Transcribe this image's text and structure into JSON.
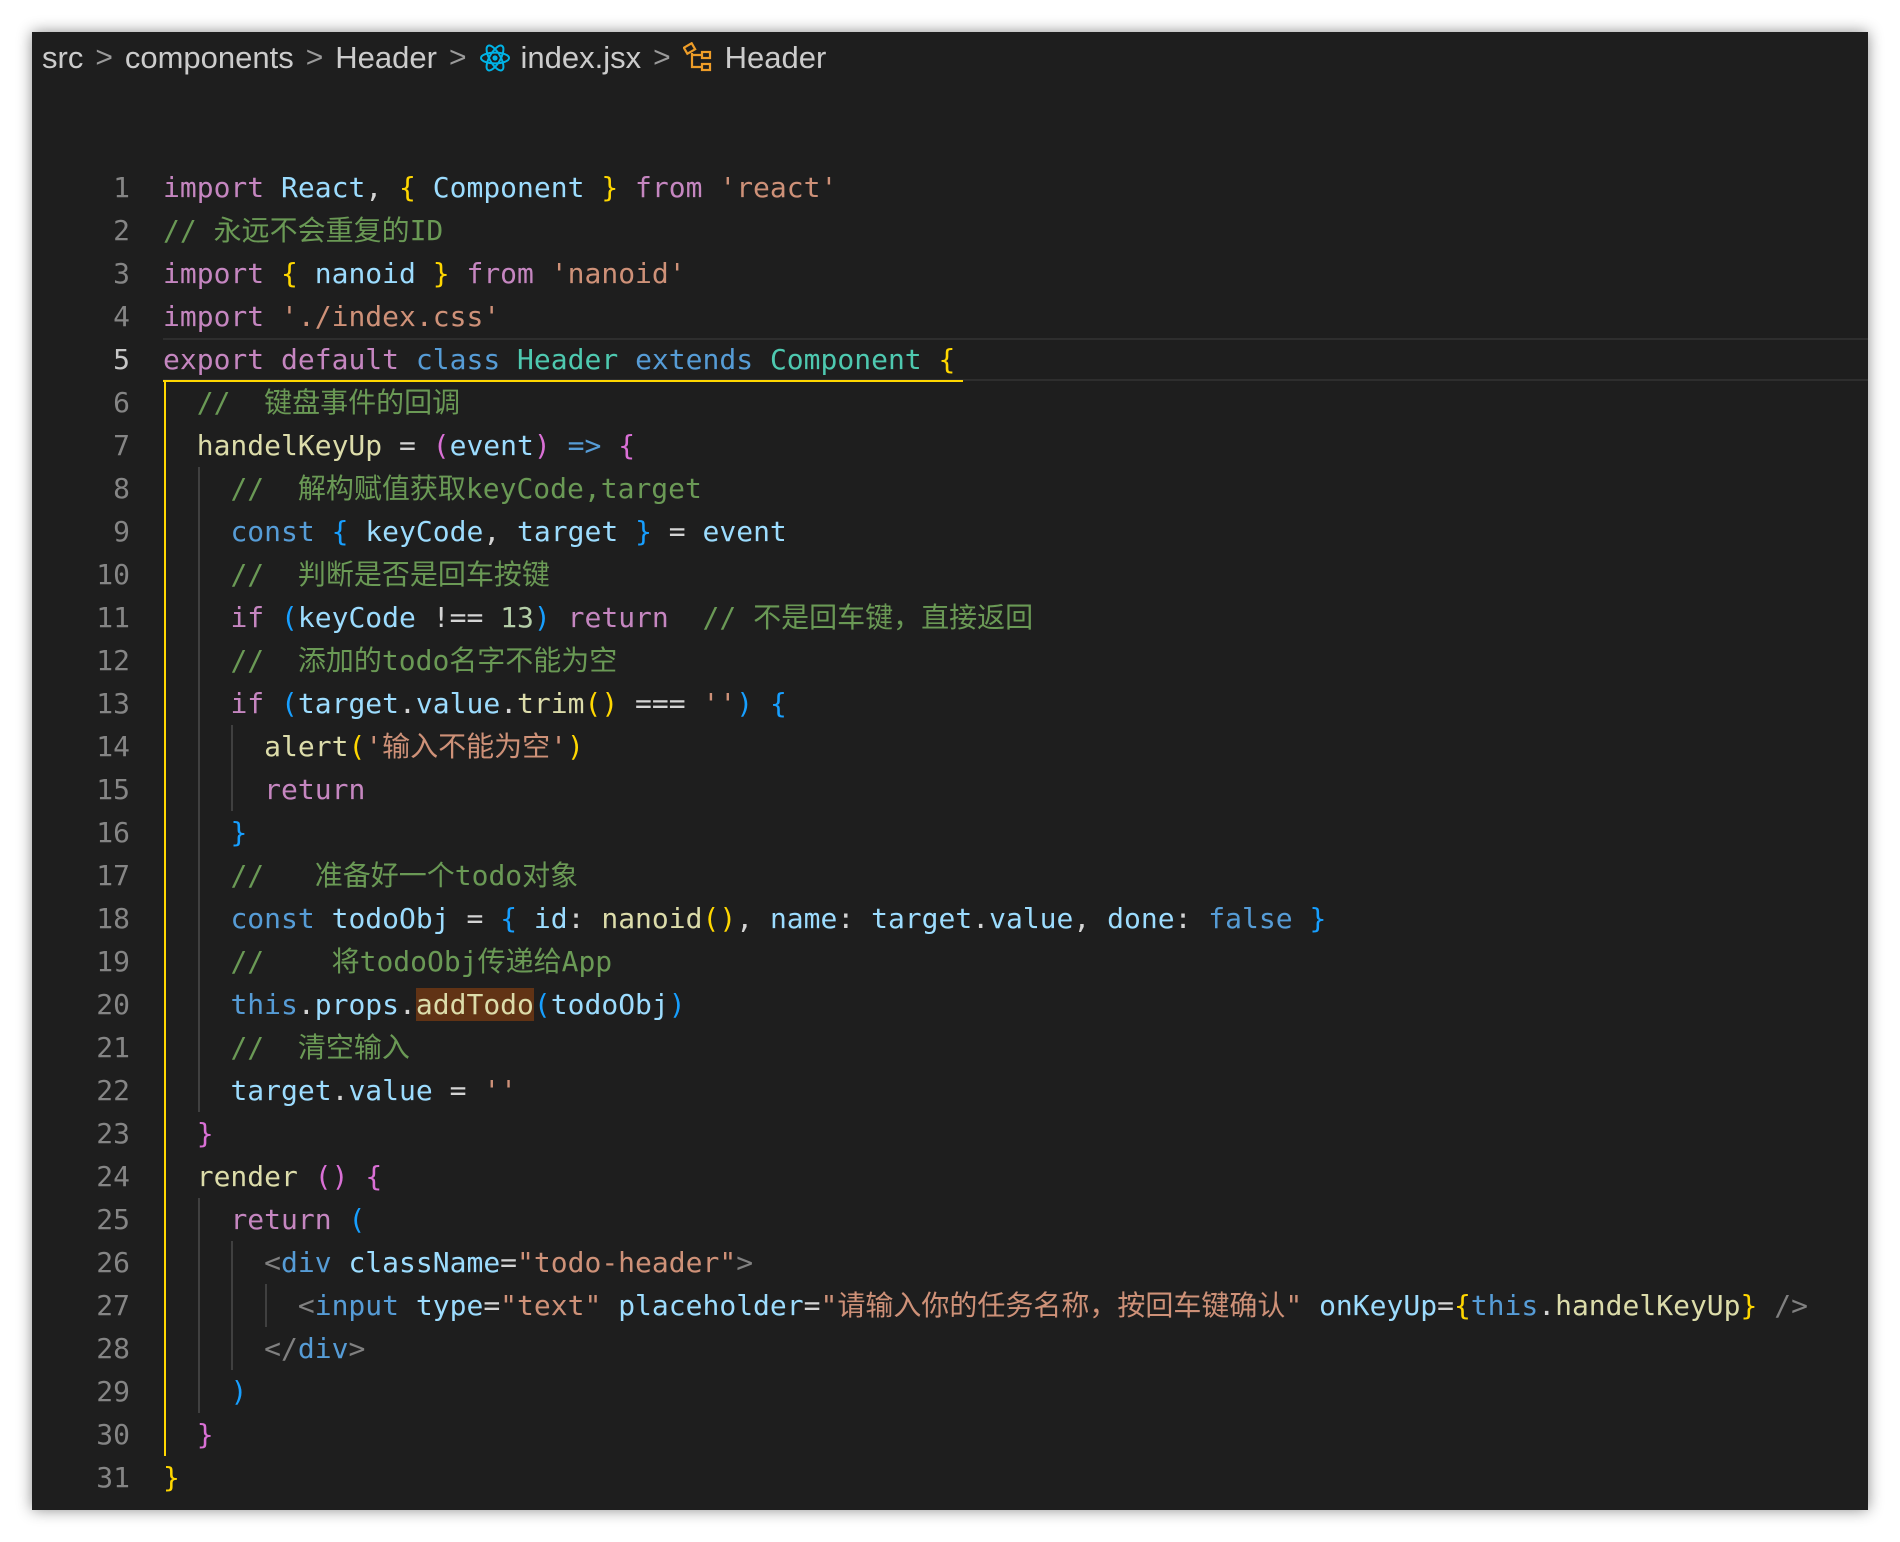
{
  "breadcrumb": {
    "src": "src",
    "components": "components",
    "header_dir": "Header",
    "file": "index.jsx",
    "symbol": "Header",
    "separator": ">",
    "file_icon": "react-icon",
    "symbol_icon": "class-symbol-icon"
  },
  "colors": {
    "background": "#1e1e1e",
    "keyword": "#c586c0",
    "type": "#4ec9b0",
    "variable": "#9cdcfe",
    "string": "#ce9178",
    "comment": "#6a9955",
    "function": "#dcdcaa",
    "bracket_gold": "#ffd700",
    "active_guide": "#ffd700"
  },
  "editor": {
    "active_line": 5,
    "line_numbers": [
      "1",
      "2",
      "3",
      "4",
      "5",
      "6",
      "7",
      "8",
      "9",
      "10",
      "11",
      "12",
      "13",
      "14",
      "15",
      "16",
      "17",
      "18",
      "19",
      "20",
      "21",
      "22",
      "23",
      "24",
      "25",
      "26",
      "27",
      "28",
      "29",
      "30",
      "31"
    ],
    "lines": [
      [
        [
          "kw",
          "import"
        ],
        [
          "op",
          " "
        ],
        [
          "va",
          "React"
        ],
        [
          "op",
          ", "
        ],
        [
          "b1",
          "{"
        ],
        [
          "op",
          " "
        ],
        [
          "va",
          "Component"
        ],
        [
          "op",
          " "
        ],
        [
          "b1",
          "}"
        ],
        [
          "op",
          " "
        ],
        [
          "kw",
          "from"
        ],
        [
          "op",
          " "
        ],
        [
          "st",
          "'react'"
        ]
      ],
      [
        [
          "cm",
          "// 永远不会重复的ID"
        ]
      ],
      [
        [
          "kw",
          "import"
        ],
        [
          "op",
          " "
        ],
        [
          "b1",
          "{"
        ],
        [
          "op",
          " "
        ],
        [
          "va",
          "nanoid"
        ],
        [
          "op",
          " "
        ],
        [
          "b1",
          "}"
        ],
        [
          "op",
          " "
        ],
        [
          "kw",
          "from"
        ],
        [
          "op",
          " "
        ],
        [
          "st",
          "'nanoid'"
        ]
      ],
      [
        [
          "kw",
          "import"
        ],
        [
          "op",
          " "
        ],
        [
          "st",
          "'./index.css'"
        ]
      ],
      [
        [
          "kw",
          "export"
        ],
        [
          "op",
          " "
        ],
        [
          "kw",
          "default"
        ],
        [
          "op",
          " "
        ],
        [
          "bl",
          "class"
        ],
        [
          "op",
          " "
        ],
        [
          "ty",
          "Header"
        ],
        [
          "op",
          " "
        ],
        [
          "bl",
          "extends"
        ],
        [
          "op",
          " "
        ],
        [
          "ty",
          "Component"
        ],
        [
          "op",
          " "
        ],
        [
          "b1",
          "{"
        ]
      ],
      [
        [
          "op",
          "  "
        ],
        [
          "cm",
          "//  键盘事件的回调"
        ]
      ],
      [
        [
          "op",
          "  "
        ],
        [
          "fn",
          "handelKeyUp"
        ],
        [
          "op",
          " = "
        ],
        [
          "b2",
          "("
        ],
        [
          "va",
          "event"
        ],
        [
          "b2",
          ")"
        ],
        [
          "op",
          " "
        ],
        [
          "bl",
          "=>"
        ],
        [
          "op",
          " "
        ],
        [
          "b2",
          "{"
        ]
      ],
      [
        [
          "op",
          "    "
        ],
        [
          "cm",
          "//  解构赋值获取keyCode,target"
        ]
      ],
      [
        [
          "op",
          "    "
        ],
        [
          "bl",
          "const"
        ],
        [
          "op",
          " "
        ],
        [
          "b3",
          "{"
        ],
        [
          "op",
          " "
        ],
        [
          "va",
          "keyCode"
        ],
        [
          "op",
          ", "
        ],
        [
          "va",
          "target"
        ],
        [
          "op",
          " "
        ],
        [
          "b3",
          "}"
        ],
        [
          "op",
          " = "
        ],
        [
          "va",
          "event"
        ]
      ],
      [
        [
          "op",
          "    "
        ],
        [
          "cm",
          "//  判断是否是回车按键"
        ]
      ],
      [
        [
          "op",
          "    "
        ],
        [
          "kw",
          "if"
        ],
        [
          "op",
          " "
        ],
        [
          "b3",
          "("
        ],
        [
          "va",
          "keyCode"
        ],
        [
          "op",
          " !== "
        ],
        [
          "nu",
          "13"
        ],
        [
          "b3",
          ")"
        ],
        [
          "op",
          " "
        ],
        [
          "kw",
          "return"
        ],
        [
          "op",
          "  "
        ],
        [
          "cm",
          "// 不是回车键，直接返回"
        ]
      ],
      [
        [
          "op",
          "    "
        ],
        [
          "cm",
          "//  添加的todo名字不能为空"
        ]
      ],
      [
        [
          "op",
          "    "
        ],
        [
          "kw",
          "if"
        ],
        [
          "op",
          " "
        ],
        [
          "b3",
          "("
        ],
        [
          "va",
          "target"
        ],
        [
          "op",
          "."
        ],
        [
          "va",
          "value"
        ],
        [
          "op",
          "."
        ],
        [
          "fn",
          "trim"
        ],
        [
          "b1",
          "()"
        ],
        [
          "op",
          " === "
        ],
        [
          "st",
          "''"
        ],
        [
          "b3",
          ")"
        ],
        [
          "op",
          " "
        ],
        [
          "b3",
          "{"
        ]
      ],
      [
        [
          "op",
          "      "
        ],
        [
          "fn",
          "alert"
        ],
        [
          "b1",
          "("
        ],
        [
          "st",
          "'输入不能为空'"
        ],
        [
          "b1",
          ")"
        ]
      ],
      [
        [
          "op",
          "      "
        ],
        [
          "kw",
          "return"
        ]
      ],
      [
        [
          "op",
          "    "
        ],
        [
          "b3",
          "}"
        ]
      ],
      [
        [
          "op",
          "    "
        ],
        [
          "cm",
          "//   准备好一个todo对象"
        ]
      ],
      [
        [
          "op",
          "    "
        ],
        [
          "bl",
          "const"
        ],
        [
          "op",
          " "
        ],
        [
          "va",
          "todoObj"
        ],
        [
          "op",
          " = "
        ],
        [
          "b3",
          "{"
        ],
        [
          "op",
          " "
        ],
        [
          "va",
          "id"
        ],
        [
          "op",
          ": "
        ],
        [
          "fn",
          "nanoid"
        ],
        [
          "b1",
          "()"
        ],
        [
          "op",
          ", "
        ],
        [
          "va",
          "name"
        ],
        [
          "op",
          ": "
        ],
        [
          "va",
          "target"
        ],
        [
          "op",
          "."
        ],
        [
          "va",
          "value"
        ],
        [
          "op",
          ", "
        ],
        [
          "va",
          "done"
        ],
        [
          "op",
          ": "
        ],
        [
          "bl",
          "false"
        ],
        [
          "op",
          " "
        ],
        [
          "b3",
          "}"
        ]
      ],
      [
        [
          "op",
          "    "
        ],
        [
          "cm",
          "//    将todoObj传递给App"
        ]
      ],
      [
        [
          "op",
          "    "
        ],
        [
          "bl",
          "this"
        ],
        [
          "op",
          "."
        ],
        [
          "va",
          "props"
        ],
        [
          "op",
          "."
        ],
        [
          "fn hl",
          "addTodo"
        ],
        [
          "b3",
          "("
        ],
        [
          "va",
          "todoObj"
        ],
        [
          "b3",
          ")"
        ]
      ],
      [
        [
          "op",
          "    "
        ],
        [
          "cm",
          "//  清空输入"
        ]
      ],
      [
        [
          "op",
          "    "
        ],
        [
          "va",
          "target"
        ],
        [
          "op",
          "."
        ],
        [
          "va",
          "value"
        ],
        [
          "op",
          " = "
        ],
        [
          "st",
          "''"
        ]
      ],
      [
        [
          "op",
          "  "
        ],
        [
          "b2",
          "}"
        ]
      ],
      [
        [
          "op",
          "  "
        ],
        [
          "fn",
          "render"
        ],
        [
          "op",
          " "
        ],
        [
          "b2",
          "()"
        ],
        [
          "op",
          " "
        ],
        [
          "b2",
          "{"
        ]
      ],
      [
        [
          "op",
          "    "
        ],
        [
          "kw",
          "return"
        ],
        [
          "op",
          " "
        ],
        [
          "b3",
          "("
        ]
      ],
      [
        [
          "op",
          "      "
        ],
        [
          "tg",
          "<"
        ],
        [
          "bl",
          "div"
        ],
        [
          "op",
          " "
        ],
        [
          "va",
          "className"
        ],
        [
          "op",
          "="
        ],
        [
          "st",
          "\"todo-header\""
        ],
        [
          "tg",
          ">"
        ]
      ],
      [
        [
          "op",
          "        "
        ],
        [
          "tg",
          "<"
        ],
        [
          "bl",
          "input"
        ],
        [
          "op",
          " "
        ],
        [
          "va",
          "type"
        ],
        [
          "op",
          "="
        ],
        [
          "st",
          "\"text\""
        ],
        [
          "op",
          " "
        ],
        [
          "va",
          "placeholder"
        ],
        [
          "op",
          "="
        ],
        [
          "st",
          "\"请输入你的任务名称，按回车键确认\""
        ],
        [
          "op",
          " "
        ],
        [
          "va",
          "onKeyUp"
        ],
        [
          "op",
          "="
        ],
        [
          "b1",
          "{"
        ],
        [
          "bl",
          "this"
        ],
        [
          "op",
          "."
        ],
        [
          "fn",
          "handelKeyUp"
        ],
        [
          "b1",
          "}"
        ],
        [
          "op",
          " "
        ],
        [
          "tg",
          "/>"
        ]
      ],
      [
        [
          "op",
          "      "
        ],
        [
          "tg",
          "</"
        ],
        [
          "bl",
          "div"
        ],
        [
          "tg",
          ">"
        ]
      ],
      [
        [
          "op",
          "    "
        ],
        [
          "b3",
          ")"
        ]
      ],
      [
        [
          "op",
          "  "
        ],
        [
          "b2",
          "}"
        ]
      ],
      [
        [
          "b1",
          "}"
        ]
      ]
    ]
  }
}
